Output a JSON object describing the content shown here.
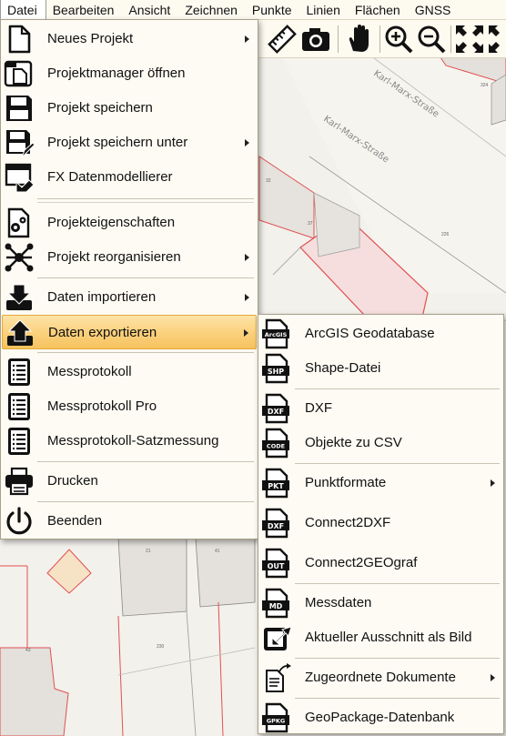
{
  "menubar": {
    "items": [
      "Datei",
      "Bearbeiten",
      "Ansicht",
      "Zeichnen",
      "Punkte",
      "Linien",
      "Flächen",
      "GNSS"
    ]
  },
  "map": {
    "street_name": "Karl-Marx-Straße",
    "parcel_numbers": [
      "324",
      "226",
      "37",
      "32",
      "230",
      "21",
      "41",
      "43"
    ]
  },
  "file_menu": {
    "items": [
      {
        "label": "Neues Projekt",
        "icon": "new-file-icon",
        "submenu": true
      },
      {
        "label": "Projektmanager öffnen",
        "icon": "project-manager-icon",
        "submenu": false
      },
      {
        "label": "Projekt speichern",
        "icon": "save-icon",
        "submenu": false
      },
      {
        "label": "Projekt speichern unter",
        "icon": "save-as-icon",
        "submenu": true
      },
      {
        "label": "FX Datenmodellierer",
        "icon": "data-modeler-icon",
        "submenu": false
      },
      {
        "label": "Projekteigenschaften",
        "icon": "project-settings-icon",
        "submenu": false
      },
      {
        "label": "Projekt reorganisieren",
        "icon": "reorganize-icon",
        "submenu": true
      },
      {
        "label": "Daten importieren",
        "icon": "import-icon",
        "submenu": true
      },
      {
        "label": "Daten exportieren",
        "icon": "export-icon",
        "submenu": true
      },
      {
        "label": "Messprotokoll",
        "icon": "protocol-icon",
        "submenu": false
      },
      {
        "label": "Messprotokoll Pro",
        "icon": "protocol-pro-icon",
        "submenu": false
      },
      {
        "label": "Messprotokoll-Satzmessung",
        "icon": "protocol-set-icon",
        "submenu": false
      },
      {
        "label": "Drucken",
        "icon": "printer-icon",
        "submenu": false
      },
      {
        "label": "Beenden",
        "icon": "power-icon",
        "submenu": false
      }
    ]
  },
  "export_menu": {
    "items": [
      {
        "label": "ArcGIS Geodatabase",
        "icon": "arcgis-icon",
        "badge": "ArcGIS",
        "submenu": false
      },
      {
        "label": "Shape-Datei",
        "icon": "shp-file-icon",
        "badge": "SHP",
        "submenu": false
      },
      {
        "label": "DXF",
        "icon": "dxf-file-icon",
        "badge": "DXF",
        "submenu": false
      },
      {
        "label": "Objekte zu CSV",
        "icon": "code-file-icon",
        "badge": "CODE",
        "submenu": false
      },
      {
        "label": "Punktformate",
        "icon": "pkt-file-icon",
        "badge": "PKT",
        "submenu": true
      },
      {
        "label": "Connect2DXF",
        "icon": "connect-dxf-icon",
        "badge": "DXF",
        "submenu": false
      },
      {
        "label": "Connect2GEOgraf",
        "icon": "out-file-icon",
        "badge": "OUT",
        "submenu": false
      },
      {
        "label": "Messdaten",
        "icon": "md-file-icon",
        "badge": "MD",
        "submenu": false
      },
      {
        "label": "Aktueller Ausschnitt als Bild",
        "icon": "export-image-icon",
        "badge": "",
        "submenu": false
      },
      {
        "label": "Zugeordnete Dokumente",
        "icon": "linked-documents-icon",
        "badge": "",
        "submenu": true
      },
      {
        "label": "GeoPackage-Datenbank",
        "icon": "gpkg-file-icon",
        "badge": "GPKG",
        "submenu": false
      }
    ]
  },
  "colors": {
    "highlight": "#f9cf7a",
    "menu_bg": "#fdfbf3",
    "parcel_red": "#e05050",
    "building_fill": "#e6e2dd"
  }
}
